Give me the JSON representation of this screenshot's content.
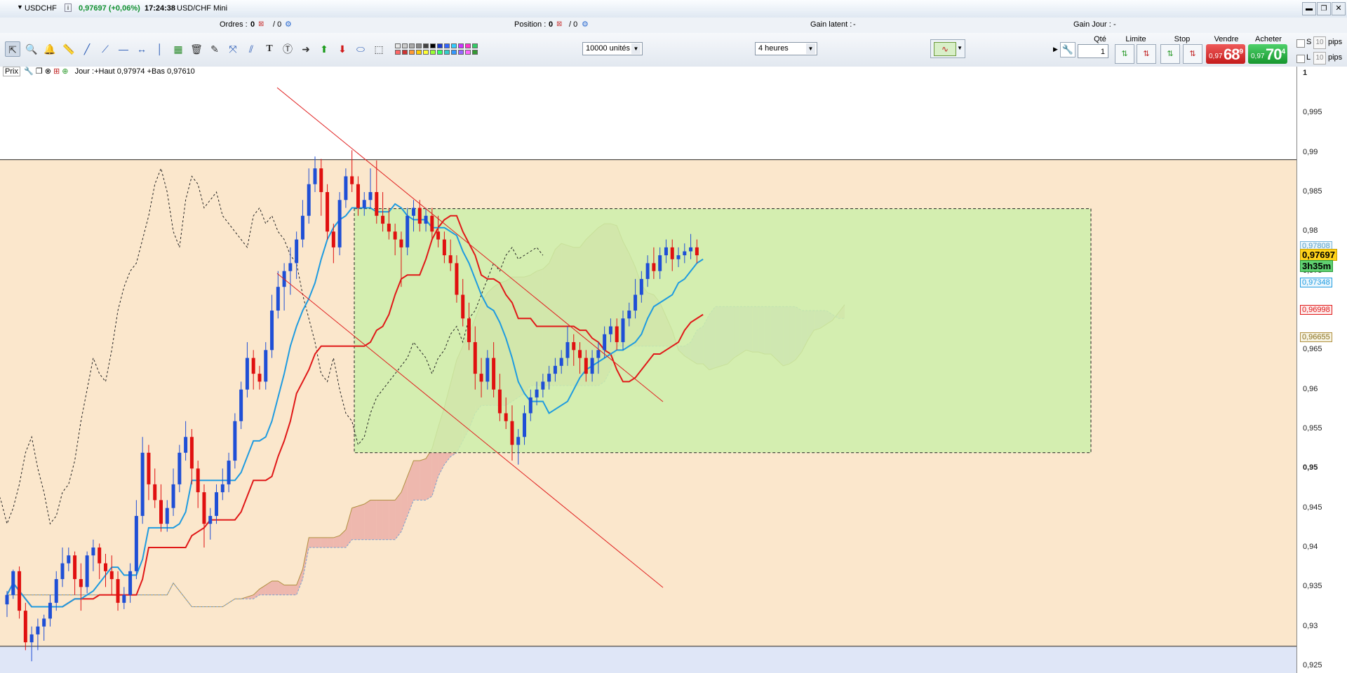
{
  "titlebar": {
    "symbol": "USDCHF",
    "info_icon": "i",
    "price": "0,97697 (+0,06%)",
    "time": "17:24:38",
    "window_title": "USD/CHF Mini",
    "controls": [
      "minimize-icon",
      "restore-icon",
      "close-icon"
    ]
  },
  "infobar": {
    "orders_label": "Ordres :",
    "orders_value": "0",
    "orders_total": "/ 0",
    "position_label": "Position :",
    "position_value": "0",
    "position_total": "/ 0",
    "latent_label": "Gain latent :",
    "latent_value": "-",
    "day_label": "Gain Jour :",
    "day_value": "-"
  },
  "toolbar": {
    "tools": [
      "cursor-icon",
      "zoom-icon",
      "alarm-icon",
      "ruler-icon",
      "line-icon",
      "trend-icon",
      "hline-icon",
      "hray-icon",
      "vline-icon",
      "fib-icon",
      "trash-icon",
      "pencil-icon",
      "cross-icon",
      "channel-icon",
      "text-icon",
      "note-icon",
      "arrow-right-icon",
      "arrow-up-icon",
      "arrow-down-icon",
      "shape-icon",
      "rect-icon"
    ],
    "quantity_select": "10000 unités",
    "timeframe_select": "4 heures"
  },
  "trade": {
    "qty_label": "Qté",
    "qty_value": "1",
    "limit_label": "Limite",
    "stop_label": "Stop",
    "sell_label": "Vendre",
    "sell_small": "0,97",
    "sell_big": "68",
    "sell_sup": "9",
    "buy_label": "Acheter",
    "buy_small": "0,97",
    "buy_big": "70",
    "buy_sup": "4",
    "s_label": "S",
    "l_label": "L",
    "pips_value": "10",
    "pips_label": "pips"
  },
  "legend": {
    "price_label": "Prix",
    "text": "Jour :+Haut 0,97974 +Bas 0,97610"
  },
  "axis": {
    "labels": [
      "1",
      "0,995",
      "0,99",
      "0,985",
      "0,98",
      "0,975",
      "0,97",
      "0,965",
      "0,96",
      "0,955",
      "0,95",
      "0,945",
      "0,94",
      "0,935",
      "0,93",
      "0,925"
    ],
    "current_price": "0,97697",
    "countdown": "3h35m",
    "kijun_tag": "0,97348",
    "tenkan_tag": "0,96998",
    "senkou_tag": "0,96655",
    "hidden_tag": "0,97808"
  },
  "colors": {
    "up_candle": "#1f4fd6",
    "down_candle": "#e01010",
    "tenkan": "#1e9be0",
    "kijun": "#e01818",
    "cloud_bull": "#e69a9a",
    "cloud_bear": "#c7a0d8",
    "green_zone": "#cdeeaa",
    "upper_band": "#fbe7cc",
    "lower_band": "#dfe6f7"
  },
  "chart_data": {
    "type": "candlestick",
    "ylim": [
      0.925,
      1.0
    ],
    "horizontal_lines": [
      0.9891,
      0.9275
    ],
    "series": [
      {
        "name": "close",
        "values": [
          0.934,
          0.937,
          0.932,
          0.93,
          0.928,
          0.929,
          0.93,
          0.931,
          0.933,
          0.936,
          0.938,
          0.939,
          0.936,
          0.935,
          0.939,
          0.94,
          0.938,
          0.937,
          0.936,
          0.933,
          0.934,
          0.937,
          0.944,
          0.952,
          0.948,
          0.946,
          0.943,
          0.945,
          0.948,
          0.952,
          0.954,
          0.95,
          0.947,
          0.943,
          0.944,
          0.947,
          0.948,
          0.951,
          0.956,
          0.96,
          0.964,
          0.962,
          0.961,
          0.965,
          0.97,
          0.973,
          0.975,
          0.976,
          0.979,
          0.982,
          0.986,
          0.988,
          0.985,
          0.98,
          0.978,
          0.984,
          0.987,
          0.986,
          0.983,
          0.984,
          0.985,
          0.982,
          0.981,
          0.98,
          0.979,
          0.978,
          0.982,
          0.983,
          0.981,
          0.982,
          0.98,
          0.979,
          0.977,
          0.976,
          0.972,
          0.969,
          0.966,
          0.962,
          0.961,
          0.964,
          0.96,
          0.957,
          0.956,
          0.953,
          0.954,
          0.957,
          0.959,
          0.96,
          0.961,
          0.962,
          0.963,
          0.964,
          0.966,
          0.965,
          0.964,
          0.962,
          0.964,
          0.965,
          0.967,
          0.968,
          0.966,
          0.969,
          0.97,
          0.972,
          0.974,
          0.976,
          0.975,
          0.977,
          0.978,
          0.9765,
          0.977,
          0.9775,
          0.978,
          0.977
        ]
      }
    ],
    "candles": [
      [
        0.9328,
        0.9345,
        0.9312,
        0.934
      ],
      [
        0.934,
        0.9372,
        0.9335,
        0.937
      ],
      [
        0.937,
        0.9376,
        0.931,
        0.932
      ],
      [
        0.932,
        0.933,
        0.927,
        0.928
      ],
      [
        0.928,
        0.93,
        0.9256,
        0.929
      ],
      [
        0.929,
        0.931,
        0.927,
        0.93
      ],
      [
        0.93,
        0.9315,
        0.9282,
        0.931
      ],
      [
        0.931,
        0.934,
        0.93,
        0.933
      ],
      [
        0.933,
        0.937,
        0.932,
        0.936
      ],
      [
        0.936,
        0.94,
        0.935,
        0.938
      ],
      [
        0.938,
        0.94,
        0.937,
        0.939
      ],
      [
        0.939,
        0.9395,
        0.934,
        0.936
      ],
      [
        0.936,
        0.938,
        0.932,
        0.935
      ],
      [
        0.935,
        0.9395,
        0.9342,
        0.939
      ],
      [
        0.939,
        0.941,
        0.937,
        0.94
      ],
      [
        0.94,
        0.9405,
        0.936,
        0.938
      ],
      [
        0.938,
        0.9392,
        0.935,
        0.937
      ],
      [
        0.937,
        0.939,
        0.934,
        0.936
      ],
      [
        0.936,
        0.937,
        0.932,
        0.933
      ],
      [
        0.933,
        0.935,
        0.9322,
        0.934
      ],
      [
        0.934,
        0.938,
        0.933,
        0.937
      ],
      [
        0.937,
        0.946,
        0.936,
        0.944
      ],
      [
        0.944,
        0.954,
        0.943,
        0.952
      ],
      [
        0.952,
        0.953,
        0.946,
        0.948
      ],
      [
        0.948,
        0.95,
        0.945,
        0.946
      ],
      [
        0.946,
        0.948,
        0.942,
        0.943
      ],
      [
        0.943,
        0.946,
        0.942,
        0.945
      ],
      [
        0.945,
        0.95,
        0.944,
        0.948
      ],
      [
        0.948,
        0.953,
        0.947,
        0.952
      ],
      [
        0.952,
        0.956,
        0.951,
        0.954
      ],
      [
        0.954,
        0.955,
        0.948,
        0.95
      ],
      [
        0.95,
        0.951,
        0.945,
        0.947
      ],
      [
        0.947,
        0.948,
        0.94,
        0.943
      ],
      [
        0.943,
        0.945,
        0.941,
        0.944
      ],
      [
        0.944,
        0.948,
        0.943,
        0.947
      ],
      [
        0.947,
        0.95,
        0.946,
        0.948
      ],
      [
        0.948,
        0.952,
        0.947,
        0.951
      ],
      [
        0.951,
        0.957,
        0.95,
        0.956
      ],
      [
        0.956,
        0.961,
        0.955,
        0.96
      ],
      [
        0.96,
        0.966,
        0.959,
        0.964
      ],
      [
        0.964,
        0.965,
        0.96,
        0.962
      ],
      [
        0.962,
        0.963,
        0.96,
        0.961
      ],
      [
        0.961,
        0.966,
        0.96,
        0.965
      ],
      [
        0.965,
        0.972,
        0.964,
        0.97
      ],
      [
        0.97,
        0.975,
        0.969,
        0.973
      ],
      [
        0.973,
        0.976,
        0.97,
        0.975
      ],
      [
        0.975,
        0.978,
        0.972,
        0.976
      ],
      [
        0.976,
        0.98,
        0.974,
        0.979
      ],
      [
        0.979,
        0.984,
        0.978,
        0.982
      ],
      [
        0.982,
        0.988,
        0.981,
        0.986
      ],
      [
        0.986,
        0.9895,
        0.985,
        0.988
      ],
      [
        0.988,
        0.9892,
        0.982,
        0.985
      ],
      [
        0.985,
        0.986,
        0.979,
        0.98
      ],
      [
        0.98,
        0.981,
        0.976,
        0.978
      ],
      [
        0.978,
        0.985,
        0.977,
        0.984
      ],
      [
        0.984,
        0.988,
        0.983,
        0.987
      ],
      [
        0.987,
        0.9903,
        0.985,
        0.986
      ],
      [
        0.986,
        0.987,
        0.982,
        0.983
      ],
      [
        0.983,
        0.985,
        0.982,
        0.984
      ],
      [
        0.984,
        0.988,
        0.983,
        0.985
      ],
      [
        0.985,
        0.989,
        0.981,
        0.982
      ],
      [
        0.982,
        0.985,
        0.98,
        0.981
      ],
      [
        0.981,
        0.983,
        0.979,
        0.98
      ],
      [
        0.98,
        0.981,
        0.977,
        0.979
      ],
      [
        0.979,
        0.98,
        0.973,
        0.978
      ],
      [
        0.978,
        0.983,
        0.977,
        0.982
      ],
      [
        0.982,
        0.984,
        0.98,
        0.983
      ],
      [
        0.983,
        0.984,
        0.98,
        0.981
      ],
      [
        0.981,
        0.983,
        0.98,
        0.982
      ],
      [
        0.982,
        0.983,
        0.979,
        0.98
      ],
      [
        0.98,
        0.982,
        0.978,
        0.979
      ],
      [
        0.979,
        0.98,
        0.976,
        0.977
      ],
      [
        0.977,
        0.979,
        0.975,
        0.976
      ],
      [
        0.976,
        0.977,
        0.971,
        0.972
      ],
      [
        0.972,
        0.974,
        0.968,
        0.969
      ],
      [
        0.969,
        0.971,
        0.965,
        0.966
      ],
      [
        0.966,
        0.968,
        0.96,
        0.962
      ],
      [
        0.962,
        0.964,
        0.959,
        0.961
      ],
      [
        0.961,
        0.965,
        0.96,
        0.964
      ],
      [
        0.964,
        0.966,
        0.959,
        0.96
      ],
      [
        0.96,
        0.962,
        0.956,
        0.957
      ],
      [
        0.957,
        0.959,
        0.955,
        0.956
      ],
      [
        0.956,
        0.958,
        0.951,
        0.953
      ],
      [
        0.953,
        0.955,
        0.9505,
        0.954
      ],
      [
        0.954,
        0.958,
        0.953,
        0.957
      ],
      [
        0.957,
        0.96,
        0.956,
        0.959
      ],
      [
        0.959,
        0.961,
        0.958,
        0.96
      ],
      [
        0.96,
        0.962,
        0.959,
        0.961
      ],
      [
        0.961,
        0.963,
        0.96,
        0.962
      ],
      [
        0.962,
        0.964,
        0.961,
        0.963
      ],
      [
        0.963,
        0.965,
        0.962,
        0.964
      ],
      [
        0.964,
        0.968,
        0.963,
        0.966
      ],
      [
        0.966,
        0.967,
        0.963,
        0.965
      ],
      [
        0.965,
        0.966,
        0.962,
        0.964
      ],
      [
        0.964,
        0.965,
        0.961,
        0.962
      ],
      [
        0.962,
        0.965,
        0.961,
        0.964
      ],
      [
        0.964,
        0.966,
        0.962,
        0.965
      ],
      [
        0.965,
        0.968,
        0.964,
        0.967
      ],
      [
        0.967,
        0.969,
        0.966,
        0.968
      ],
      [
        0.968,
        0.969,
        0.965,
        0.966
      ],
      [
        0.966,
        0.97,
        0.965,
        0.969
      ],
      [
        0.969,
        0.971,
        0.968,
        0.97
      ],
      [
        0.97,
        0.974,
        0.969,
        0.972
      ],
      [
        0.972,
        0.975,
        0.971,
        0.974
      ],
      [
        0.974,
        0.977,
        0.973,
        0.976
      ],
      [
        0.976,
        0.978,
        0.974,
        0.975
      ],
      [
        0.975,
        0.978,
        0.974,
        0.977
      ],
      [
        0.977,
        0.979,
        0.976,
        0.978
      ],
      [
        0.978,
        0.979,
        0.975,
        0.9765
      ],
      [
        0.9765,
        0.978,
        0.9755,
        0.977
      ],
      [
        0.977,
        0.9785,
        0.976,
        0.9775
      ],
      [
        0.9775,
        0.9797,
        0.9765,
        0.978
      ],
      [
        0.978,
        0.979,
        0.976,
        0.977
      ]
    ]
  }
}
